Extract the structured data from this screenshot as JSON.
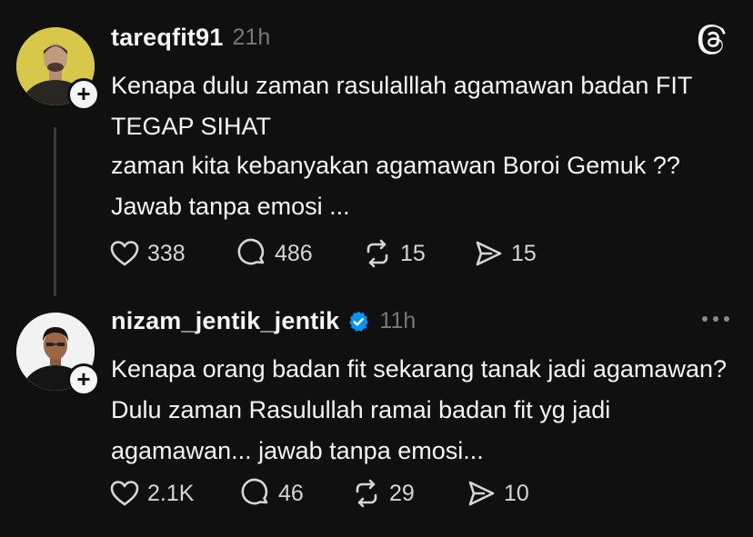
{
  "posts": [
    {
      "username": "tareqfit91",
      "timestamp": "21h",
      "paragraphs": [
        "Kenapa dulu zaman rasulalllah agamawan  badan FIT TEGAP SIHAT",
        "zaman kita kebanyakan agamawan Boroi Gemuk ?? Jawab tanpa emosi ..."
      ],
      "likes": "338",
      "replies": "486",
      "reposts": "15",
      "shares": "15",
      "corner_icon": "threads-logo-icon"
    },
    {
      "username": "nizam_jentik_jentik",
      "verified": true,
      "timestamp": "11h",
      "paragraphs": [
        "Kenapa orang badan fit sekarang tanak jadi agamawan? Dulu zaman Rasulullah ramai badan fit yg jadi agamawan... jawab tanpa emosi..."
      ],
      "likes": "2.1K",
      "replies": "46",
      "reposts": "29",
      "shares": "10",
      "corner_icon": "more-options-icon"
    }
  ],
  "follow_symbol": "+",
  "colors": {
    "background": "#101010",
    "text": "#f3f5f7",
    "muted": "#777777",
    "verified": "#0095f6"
  }
}
